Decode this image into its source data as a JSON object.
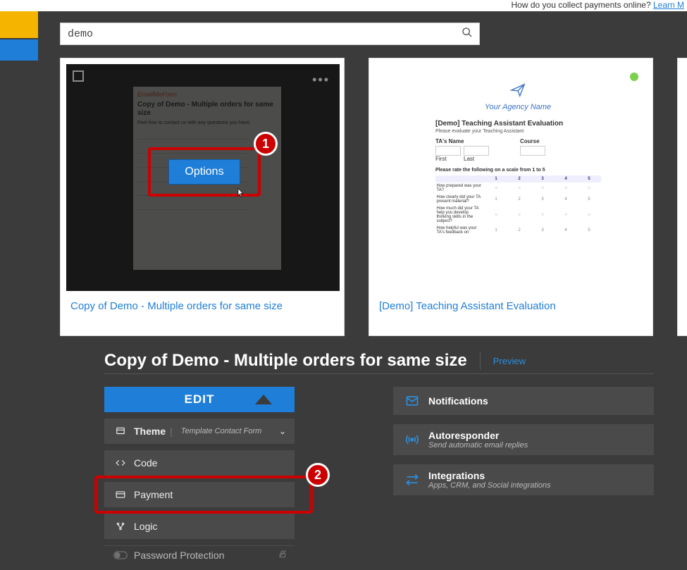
{
  "banner": {
    "text": "How do you collect payments online? ",
    "link": "Learn M"
  },
  "search": {
    "value": "demo"
  },
  "cards": [
    {
      "title": "Copy of Demo - Multiple orders for same size",
      "mock": {
        "brand": "EmailMeForm",
        "heading": "Copy of Demo - Multiple orders for same size",
        "sub": "Feel free to contact us with any questions you have."
      },
      "options_label": "Options"
    },
    {
      "title": "[Demo] Teaching Assistant Evaluation",
      "mock": {
        "agency": "Your Agency Name",
        "heading": "[Demo] Teaching Assistant Evaluation",
        "sub": "Please evaluate your Teaching Assistant",
        "ta_label": "TA's Name",
        "course_label": "Course",
        "first": "First",
        "last": "Last",
        "scale": "Please rate the following on a scale from 1 to 5",
        "rows": [
          "How prepared was your TA?",
          "How clearly did your TA present material?",
          "How much did your TA help you develop thinking skills in the subject?",
          "How helpful was your TA's feedback on"
        ]
      }
    }
  ],
  "panel": {
    "title": "Copy of Demo - Multiple orders for same size",
    "preview": "Preview",
    "edit": "EDIT",
    "menu": {
      "theme": {
        "label": "Theme",
        "sub": "Template Contact Form"
      },
      "code": "Code",
      "payment": "Payment",
      "logic": "Logic",
      "password": "Password Protection"
    },
    "right": {
      "notifications": "Notifications",
      "autoresponder": {
        "t": "Autoresponder",
        "s": "Send automatic email replies"
      },
      "integrations": {
        "t": "Integrations",
        "s": "Apps, CRM, and Social integrations"
      }
    }
  },
  "badges": {
    "one": "1",
    "two": "2"
  }
}
